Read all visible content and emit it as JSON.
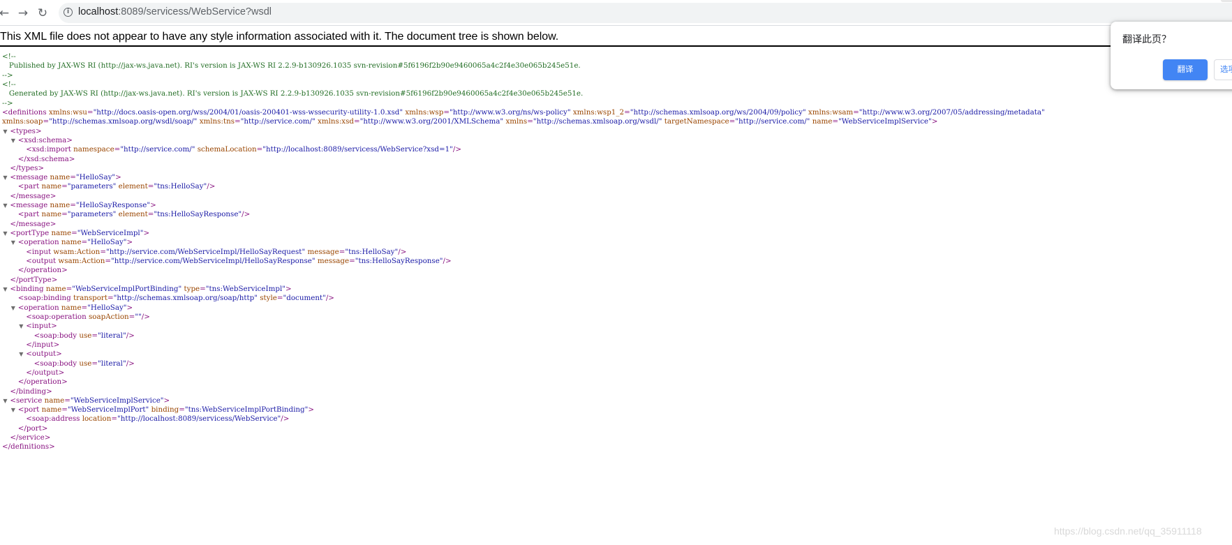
{
  "browser": {
    "url_host": "localhost",
    "url_rest": ":8089/servicess/WebService?wsdl",
    "back_icon": "back-arrow-icon",
    "forward_icon": "forward-arrow-icon",
    "reload_icon": "reload-icon",
    "info_icon": "info-icon"
  },
  "xml_notice": "This XML file does not appear to have any style information associated with it. The document tree is shown below.",
  "translate_popup": {
    "title": "翻译此页？",
    "translate_button": "翻译",
    "second_button": "选项"
  },
  "watermark": "https://blog.csdn.net/qq_35911118",
  "colors": {
    "tag": "#881280",
    "attr_name": "#994500",
    "attr_value": "#1a1aa6",
    "comment": "#236e25",
    "translate_button": "#4285f4"
  },
  "lines": [
    {
      "indent": 0,
      "toggle": false,
      "parts": [
        {
          "c": "cm",
          "t": "<!--"
        }
      ]
    },
    {
      "indent": 0,
      "toggle": false,
      "parts": [
        {
          "c": "cm",
          "t": "   Published by JAX-WS RI (http://jax-ws.java.net). RI's version is JAX-WS RI 2.2.9-b130926.1035 svn-revision#5f6196f2b90e9460065a4c2f4e30e065b245e51e."
        }
      ]
    },
    {
      "indent": 0,
      "toggle": false,
      "parts": [
        {
          "c": "cm",
          "t": "-->"
        }
      ]
    },
    {
      "indent": 0,
      "toggle": false,
      "parts": [
        {
          "c": "cm",
          "t": "<!--"
        }
      ]
    },
    {
      "indent": 0,
      "toggle": false,
      "parts": [
        {
          "c": "cm",
          "t": "   Generated by JAX-WS RI (http://jax-ws.java.net). RI's version is JAX-WS RI 2.2.9-b130926.1035 svn-revision#5f6196f2b90e9460065a4c2f4e30e065b245e51e."
        }
      ]
    },
    {
      "indent": 0,
      "toggle": false,
      "parts": [
        {
          "c": "cm",
          "t": "-->"
        }
      ]
    },
    {
      "indent": 0,
      "toggle": false,
      "parts": [
        {
          "c": "t",
          "t": "<definitions "
        },
        {
          "c": "an",
          "t": "xmlns:wsu"
        },
        {
          "c": "t",
          "t": "="
        },
        {
          "c": "av",
          "t": "\"http://docs.oasis-open.org/wss/2004/01/oasis-200401-wss-wssecurity-utility-1.0.xsd\""
        },
        {
          "c": "t",
          "t": " "
        },
        {
          "c": "an",
          "t": "xmlns:wsp"
        },
        {
          "c": "t",
          "t": "="
        },
        {
          "c": "av",
          "t": "\"http://www.w3.org/ns/ws-policy\""
        },
        {
          "c": "t",
          "t": " "
        },
        {
          "c": "an",
          "t": "xmlns:wsp1_2"
        },
        {
          "c": "t",
          "t": "="
        },
        {
          "c": "av",
          "t": "\"http://schemas.xmlsoap.org/ws/2004/09/policy\""
        },
        {
          "c": "t",
          "t": " "
        },
        {
          "c": "an",
          "t": "xmlns:wsam"
        },
        {
          "c": "t",
          "t": "="
        },
        {
          "c": "av",
          "t": "\"http://www.w3.org/2007/05/addressing/metadata\""
        }
      ]
    },
    {
      "indent": 0,
      "toggle": false,
      "parts": [
        {
          "c": "an",
          "t": "xmlns:soap"
        },
        {
          "c": "t",
          "t": "="
        },
        {
          "c": "av",
          "t": "\"http://schemas.xmlsoap.org/wsdl/soap/\""
        },
        {
          "c": "t",
          "t": " "
        },
        {
          "c": "an",
          "t": "xmlns:tns"
        },
        {
          "c": "t",
          "t": "="
        },
        {
          "c": "av",
          "t": "\"http://service.com/\""
        },
        {
          "c": "t",
          "t": " "
        },
        {
          "c": "an",
          "t": "xmlns:xsd"
        },
        {
          "c": "t",
          "t": "="
        },
        {
          "c": "av",
          "t": "\"http://www.w3.org/2001/XMLSchema\""
        },
        {
          "c": "t",
          "t": " "
        },
        {
          "c": "an",
          "t": "xmlns"
        },
        {
          "c": "t",
          "t": "="
        },
        {
          "c": "av",
          "t": "\"http://schemas.xmlsoap.org/wsdl/\""
        },
        {
          "c": "t",
          "t": " "
        },
        {
          "c": "an",
          "t": "targetNamespace"
        },
        {
          "c": "t",
          "t": "="
        },
        {
          "c": "av",
          "t": "\"http://service.com/\""
        },
        {
          "c": "t",
          "t": " "
        },
        {
          "c": "an",
          "t": "name"
        },
        {
          "c": "t",
          "t": "="
        },
        {
          "c": "av",
          "t": "\"WebServiceImplService\""
        },
        {
          "c": "t",
          "t": ">"
        }
      ]
    },
    {
      "indent": 1,
      "toggle": true,
      "parts": [
        {
          "c": "t",
          "t": "<types>"
        }
      ]
    },
    {
      "indent": 2,
      "toggle": true,
      "parts": [
        {
          "c": "t",
          "t": "<xsd:schema>"
        }
      ]
    },
    {
      "indent": 3,
      "toggle": false,
      "parts": [
        {
          "c": "t",
          "t": "<xsd:import "
        },
        {
          "c": "an",
          "t": "namespace"
        },
        {
          "c": "t",
          "t": "="
        },
        {
          "c": "av",
          "t": "\"http://service.com/\""
        },
        {
          "c": "t",
          "t": " "
        },
        {
          "c": "an",
          "t": "schemaLocation"
        },
        {
          "c": "t",
          "t": "="
        },
        {
          "c": "av",
          "t": "\"http://localhost:8089/servicess/WebService?xsd=1\""
        },
        {
          "c": "t",
          "t": "/>"
        }
      ]
    },
    {
      "indent": 2,
      "toggle": false,
      "parts": [
        {
          "c": "t",
          "t": "</xsd:schema>"
        }
      ]
    },
    {
      "indent": 1,
      "toggle": false,
      "parts": [
        {
          "c": "t",
          "t": "</types>"
        }
      ]
    },
    {
      "indent": 1,
      "toggle": true,
      "parts": [
        {
          "c": "t",
          "t": "<message "
        },
        {
          "c": "an",
          "t": "name"
        },
        {
          "c": "t",
          "t": "="
        },
        {
          "c": "av",
          "t": "\"HelloSay\""
        },
        {
          "c": "t",
          "t": ">"
        }
      ]
    },
    {
      "indent": 2,
      "toggle": false,
      "parts": [
        {
          "c": "t",
          "t": "<part "
        },
        {
          "c": "an",
          "t": "name"
        },
        {
          "c": "t",
          "t": "="
        },
        {
          "c": "av",
          "t": "\"parameters\""
        },
        {
          "c": "t",
          "t": " "
        },
        {
          "c": "an",
          "t": "element"
        },
        {
          "c": "t",
          "t": "="
        },
        {
          "c": "av",
          "t": "\"tns:HelloSay\""
        },
        {
          "c": "t",
          "t": "/>"
        }
      ]
    },
    {
      "indent": 1,
      "toggle": false,
      "parts": [
        {
          "c": "t",
          "t": "</message>"
        }
      ]
    },
    {
      "indent": 1,
      "toggle": true,
      "parts": [
        {
          "c": "t",
          "t": "<message "
        },
        {
          "c": "an",
          "t": "name"
        },
        {
          "c": "t",
          "t": "="
        },
        {
          "c": "av",
          "t": "\"HelloSayResponse\""
        },
        {
          "c": "t",
          "t": ">"
        }
      ]
    },
    {
      "indent": 2,
      "toggle": false,
      "parts": [
        {
          "c": "t",
          "t": "<part "
        },
        {
          "c": "an",
          "t": "name"
        },
        {
          "c": "t",
          "t": "="
        },
        {
          "c": "av",
          "t": "\"parameters\""
        },
        {
          "c": "t",
          "t": " "
        },
        {
          "c": "an",
          "t": "element"
        },
        {
          "c": "t",
          "t": "="
        },
        {
          "c": "av",
          "t": "\"tns:HelloSayResponse\""
        },
        {
          "c": "t",
          "t": "/>"
        }
      ]
    },
    {
      "indent": 1,
      "toggle": false,
      "parts": [
        {
          "c": "t",
          "t": "</message>"
        }
      ]
    },
    {
      "indent": 1,
      "toggle": true,
      "parts": [
        {
          "c": "t",
          "t": "<portType "
        },
        {
          "c": "an",
          "t": "name"
        },
        {
          "c": "t",
          "t": "="
        },
        {
          "c": "av",
          "t": "\"WebServiceImpl\""
        },
        {
          "c": "t",
          "t": ">"
        }
      ]
    },
    {
      "indent": 2,
      "toggle": true,
      "parts": [
        {
          "c": "t",
          "t": "<operation "
        },
        {
          "c": "an",
          "t": "name"
        },
        {
          "c": "t",
          "t": "="
        },
        {
          "c": "av",
          "t": "\"HelloSay\""
        },
        {
          "c": "t",
          "t": ">"
        }
      ]
    },
    {
      "indent": 3,
      "toggle": false,
      "parts": [
        {
          "c": "t",
          "t": "<input "
        },
        {
          "c": "an",
          "t": "wsam:Action"
        },
        {
          "c": "t",
          "t": "="
        },
        {
          "c": "av",
          "t": "\"http://service.com/WebServiceImpl/HelloSayRequest\""
        },
        {
          "c": "t",
          "t": " "
        },
        {
          "c": "an",
          "t": "message"
        },
        {
          "c": "t",
          "t": "="
        },
        {
          "c": "av",
          "t": "\"tns:HelloSay\""
        },
        {
          "c": "t",
          "t": "/>"
        }
      ]
    },
    {
      "indent": 3,
      "toggle": false,
      "parts": [
        {
          "c": "t",
          "t": "<output "
        },
        {
          "c": "an",
          "t": "wsam:Action"
        },
        {
          "c": "t",
          "t": "="
        },
        {
          "c": "av",
          "t": "\"http://service.com/WebServiceImpl/HelloSayResponse\""
        },
        {
          "c": "t",
          "t": " "
        },
        {
          "c": "an",
          "t": "message"
        },
        {
          "c": "t",
          "t": "="
        },
        {
          "c": "av",
          "t": "\"tns:HelloSayResponse\""
        },
        {
          "c": "t",
          "t": "/>"
        }
      ]
    },
    {
      "indent": 2,
      "toggle": false,
      "parts": [
        {
          "c": "t",
          "t": "</operation>"
        }
      ]
    },
    {
      "indent": 1,
      "toggle": false,
      "parts": [
        {
          "c": "t",
          "t": "</portType>"
        }
      ]
    },
    {
      "indent": 1,
      "toggle": true,
      "parts": [
        {
          "c": "t",
          "t": "<binding "
        },
        {
          "c": "an",
          "t": "name"
        },
        {
          "c": "t",
          "t": "="
        },
        {
          "c": "av",
          "t": "\"WebServiceImplPortBinding\""
        },
        {
          "c": "t",
          "t": " "
        },
        {
          "c": "an",
          "t": "type"
        },
        {
          "c": "t",
          "t": "="
        },
        {
          "c": "av",
          "t": "\"tns:WebServiceImpl\""
        },
        {
          "c": "t",
          "t": ">"
        }
      ]
    },
    {
      "indent": 2,
      "toggle": false,
      "parts": [
        {
          "c": "t",
          "t": "<soap:binding "
        },
        {
          "c": "an",
          "t": "transport"
        },
        {
          "c": "t",
          "t": "="
        },
        {
          "c": "av",
          "t": "\"http://schemas.xmlsoap.org/soap/http\""
        },
        {
          "c": "t",
          "t": " "
        },
        {
          "c": "an",
          "t": "style"
        },
        {
          "c": "t",
          "t": "="
        },
        {
          "c": "av",
          "t": "\"document\""
        },
        {
          "c": "t",
          "t": "/>"
        }
      ]
    },
    {
      "indent": 2,
      "toggle": true,
      "parts": [
        {
          "c": "t",
          "t": "<operation "
        },
        {
          "c": "an",
          "t": "name"
        },
        {
          "c": "t",
          "t": "="
        },
        {
          "c": "av",
          "t": "\"HelloSay\""
        },
        {
          "c": "t",
          "t": ">"
        }
      ]
    },
    {
      "indent": 3,
      "toggle": false,
      "parts": [
        {
          "c": "t",
          "t": "<soap:operation "
        },
        {
          "c": "an",
          "t": "soapAction"
        },
        {
          "c": "t",
          "t": "="
        },
        {
          "c": "av",
          "t": "\"\""
        },
        {
          "c": "t",
          "t": "/>"
        }
      ]
    },
    {
      "indent": 3,
      "toggle": true,
      "parts": [
        {
          "c": "t",
          "t": "<input>"
        }
      ]
    },
    {
      "indent": 4,
      "toggle": false,
      "parts": [
        {
          "c": "t",
          "t": "<soap:body "
        },
        {
          "c": "an",
          "t": "use"
        },
        {
          "c": "t",
          "t": "="
        },
        {
          "c": "av",
          "t": "\"literal\""
        },
        {
          "c": "t",
          "t": "/>"
        }
      ]
    },
    {
      "indent": 3,
      "toggle": false,
      "parts": [
        {
          "c": "t",
          "t": "</input>"
        }
      ]
    },
    {
      "indent": 3,
      "toggle": true,
      "parts": [
        {
          "c": "t",
          "t": "<output>"
        }
      ]
    },
    {
      "indent": 4,
      "toggle": false,
      "parts": [
        {
          "c": "t",
          "t": "<soap:body "
        },
        {
          "c": "an",
          "t": "use"
        },
        {
          "c": "t",
          "t": "="
        },
        {
          "c": "av",
          "t": "\"literal\""
        },
        {
          "c": "t",
          "t": "/>"
        }
      ]
    },
    {
      "indent": 3,
      "toggle": false,
      "parts": [
        {
          "c": "t",
          "t": "</output>"
        }
      ]
    },
    {
      "indent": 2,
      "toggle": false,
      "parts": [
        {
          "c": "t",
          "t": "</operation>"
        }
      ]
    },
    {
      "indent": 1,
      "toggle": false,
      "parts": [
        {
          "c": "t",
          "t": "</binding>"
        }
      ]
    },
    {
      "indent": 1,
      "toggle": true,
      "parts": [
        {
          "c": "t",
          "t": "<service "
        },
        {
          "c": "an",
          "t": "name"
        },
        {
          "c": "t",
          "t": "="
        },
        {
          "c": "av",
          "t": "\"WebServiceImplService\""
        },
        {
          "c": "t",
          "t": ">"
        }
      ]
    },
    {
      "indent": 2,
      "toggle": true,
      "parts": [
        {
          "c": "t",
          "t": "<port "
        },
        {
          "c": "an",
          "t": "name"
        },
        {
          "c": "t",
          "t": "="
        },
        {
          "c": "av",
          "t": "\"WebServiceImplPort\""
        },
        {
          "c": "t",
          "t": " "
        },
        {
          "c": "an",
          "t": "binding"
        },
        {
          "c": "t",
          "t": "="
        },
        {
          "c": "av",
          "t": "\"tns:WebServiceImplPortBinding\""
        },
        {
          "c": "t",
          "t": ">"
        }
      ]
    },
    {
      "indent": 3,
      "toggle": false,
      "parts": [
        {
          "c": "t",
          "t": "<soap:address "
        },
        {
          "c": "an",
          "t": "location"
        },
        {
          "c": "t",
          "t": "="
        },
        {
          "c": "av",
          "t": "\"http://localhost:8089/servicess/WebService\""
        },
        {
          "c": "t",
          "t": "/>"
        }
      ]
    },
    {
      "indent": 2,
      "toggle": false,
      "parts": [
        {
          "c": "t",
          "t": "</port>"
        }
      ]
    },
    {
      "indent": 1,
      "toggle": false,
      "parts": [
        {
          "c": "t",
          "t": "</service>"
        }
      ]
    },
    {
      "indent": 0,
      "toggle": false,
      "parts": [
        {
          "c": "t",
          "t": "</definitions>"
        }
      ]
    }
  ]
}
